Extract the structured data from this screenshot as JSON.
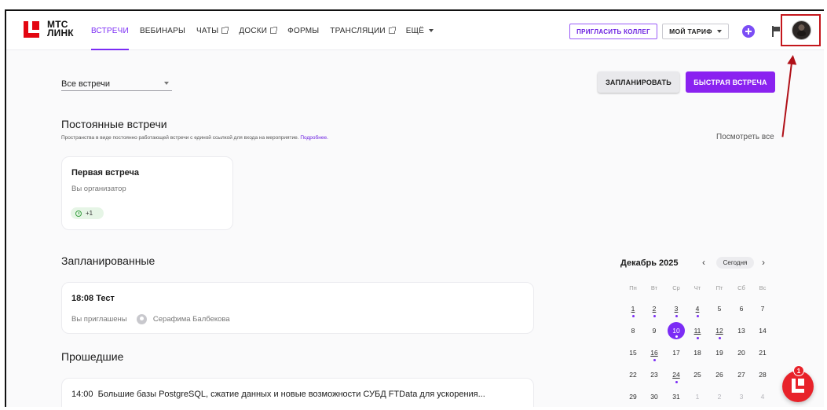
{
  "header": {
    "logo_line1": "МТС",
    "logo_line2": "ЛИНК",
    "nav": [
      {
        "label": "ВСТРЕЧИ"
      },
      {
        "label": "ВЕБИНАРЫ"
      },
      {
        "label": "ЧАТЫ"
      },
      {
        "label": "ДОСКИ"
      },
      {
        "label": "ФОРМЫ"
      },
      {
        "label": "ТРАНСЛЯЦИИ"
      },
      {
        "label": "ЕЩЁ"
      }
    ],
    "invite_label": "ПРИГЛАСИТЬ КОЛЛЕГ",
    "tariff_label": "МОЙ ТАРИФ"
  },
  "toolbar": {
    "filter_value": "Все встречи",
    "plan_label": "ЗАПЛАНИРОВАТЬ",
    "quick_label": "БЫСТРАЯ ВСТРЕЧА"
  },
  "permanent": {
    "title": "Постоянные встречи",
    "subtitle": "Пространства в виде постоянно работающей встречи с единой ссылкой для входа на мероприятие.",
    "more_link": "Подробнее.",
    "see_all": "Посмотреть все",
    "card": {
      "title": "Первая встреча",
      "role": "Вы организатор",
      "chip": "+1"
    }
  },
  "scheduled": {
    "title": "Запланированные",
    "item": {
      "time": "18:08",
      "name": "Тест",
      "status": "Вы приглашены",
      "organizer": "Серафима Балбекова"
    }
  },
  "past": {
    "title": "Прошедшие",
    "item": {
      "time": "14:00",
      "name": "Большие базы PostgreSQL, сжатие данных и новые возможности СУБД FTData для ускорения..."
    }
  },
  "calendar": {
    "month": "Декабрь 2025",
    "today_label": "Сегодня",
    "weekdays": [
      "Пн",
      "Вт",
      "Ср",
      "Чт",
      "Пт",
      "Сб",
      "Вс"
    ],
    "weeks": [
      [
        "1",
        "2",
        "3",
        "4",
        "5",
        "6",
        "7"
      ],
      [
        "8",
        "9",
        "10",
        "11",
        "12",
        "13",
        "14"
      ],
      [
        "15",
        "16",
        "17",
        "18",
        "19",
        "20",
        "21"
      ],
      [
        "22",
        "23",
        "24",
        "25",
        "26",
        "27",
        "28"
      ],
      [
        "29",
        "30",
        "31",
        "1",
        "2",
        "3",
        "4"
      ]
    ],
    "selected_day": "10"
  },
  "support": {
    "badge": "1"
  },
  "colors": {
    "accent": "#7b2cf5",
    "brand": "#e30611",
    "annotation": "#c4161c"
  }
}
